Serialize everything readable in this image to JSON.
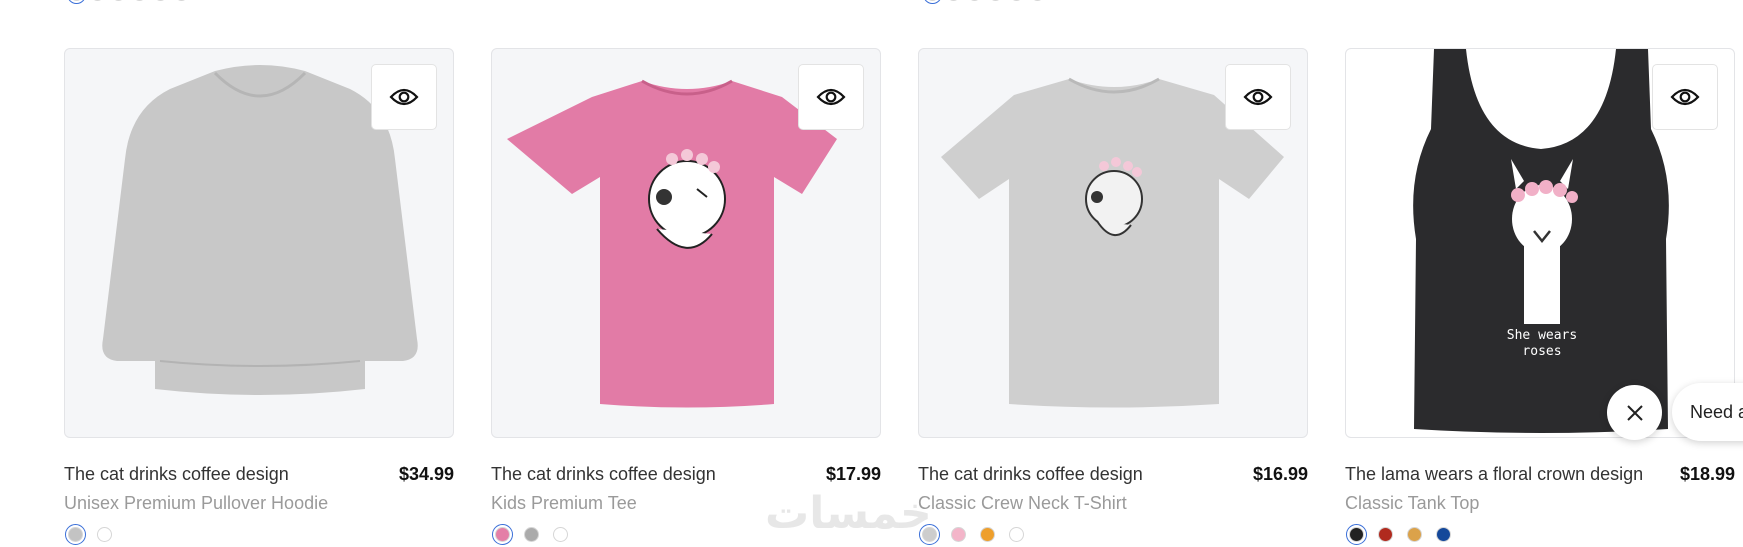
{
  "top_swatches_left": [
    "#ffffff",
    "#f3b8cc",
    "#1f1f1f",
    "#24407a",
    "#f0a91a",
    "#555555"
  ],
  "top_swatches_right": [
    "#ffffff",
    "#b5b5b5",
    "#a9a9a9",
    "#f8dd9a",
    "#ffffff",
    "#e3f1f8"
  ],
  "products": [
    {
      "title": "The cat drinks coffee design",
      "price": "$34.99",
      "subtitle": "Unisex Premium Pullover Hoodie",
      "garment": "hoodie",
      "garment_color": "#c8c8c8",
      "swatches": [
        "#c3c3c3",
        "#ffffff"
      ],
      "selected_swatch": 0
    },
    {
      "title": "The cat drinks coffee design",
      "price": "$17.99",
      "subtitle": "Kids Premium Tee",
      "garment": "tee",
      "garment_color": "#e27ba6",
      "swatches": [
        "#e47fa7",
        "#ababab",
        "#ffffff"
      ],
      "selected_swatch": 0
    },
    {
      "title": "The cat drinks coffee design",
      "price": "$16.99",
      "subtitle": "Classic Crew Neck T-Shirt",
      "garment": "tee",
      "garment_color": "#cfcfcf",
      "swatches": [
        "#cdcdcd",
        "#f3b5c9",
        "#ee9f2c",
        "#ffffff"
      ],
      "selected_swatch": 0
    },
    {
      "title": "The lama wears a floral crown design",
      "price": "$18.99",
      "subtitle": "Classic Tank Top",
      "garment": "tank",
      "garment_color": "#2b2b2d",
      "print_text_line1": "She wears",
      "print_text_line2": "roses",
      "swatches": [
        "#222222",
        "#b02a1e",
        "#dba24a",
        "#14489a"
      ],
      "selected_swatch": 0
    }
  ],
  "chat": {
    "bubble_text": "Need a",
    "close_icon": "close-icon"
  },
  "watermark_text": "خمسات"
}
